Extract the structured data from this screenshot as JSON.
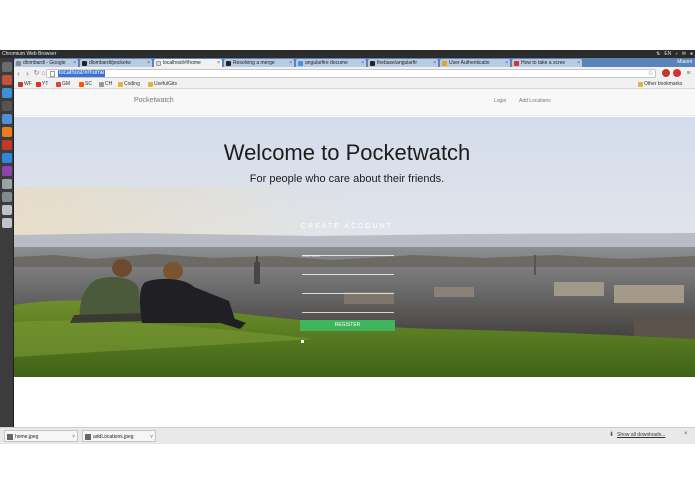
{
  "os": {
    "title": "Chromium Web Browser",
    "tray": [
      "⇅",
      "EN",
      "♪",
      "✉",
      "●"
    ]
  },
  "tabs": [
    {
      "label": "dlombardi - Google",
      "active": false
    },
    {
      "label": "dlombardi/pocketw",
      "active": false
    },
    {
      "label": "localhost/#/home",
      "active": true
    },
    {
      "label": "Resolving a merge",
      "active": false
    },
    {
      "label": "angularfire docume",
      "active": false
    },
    {
      "label": "firebase/angularfir",
      "active": false
    },
    {
      "label": "User Authenticatio",
      "active": false
    },
    {
      "label": "How to take a scree",
      "active": false
    }
  ],
  "window_control": "Miaoni",
  "toolbar": {
    "url": "localhost/#/home"
  },
  "bookmarks": {
    "items": [
      "WF",
      "YT",
      "GM",
      "SC",
      "CH",
      "Coding",
      "UsefulGits"
    ],
    "other": "Other bookmarks"
  },
  "app": {
    "brand": "Pocketwatch",
    "nav_login": "Login",
    "nav_add": "Add Locations",
    "hero_title": "Welcome to Pocketwatch",
    "hero_subtitle": "For people who care about their friends.",
    "form_heading": "CREATE ACCOUNT",
    "username_placeholder": "Username",
    "register_label": "REGISTER"
  },
  "downloads": {
    "items": [
      "home.jpeg",
      "addLocations.jpeg"
    ],
    "show_all": "Show all downloads...",
    "close": "×"
  },
  "colors": {
    "accent": "#3eb55c",
    "tabstrip": "#5b83b8",
    "launcher": "#3c3c3c"
  }
}
